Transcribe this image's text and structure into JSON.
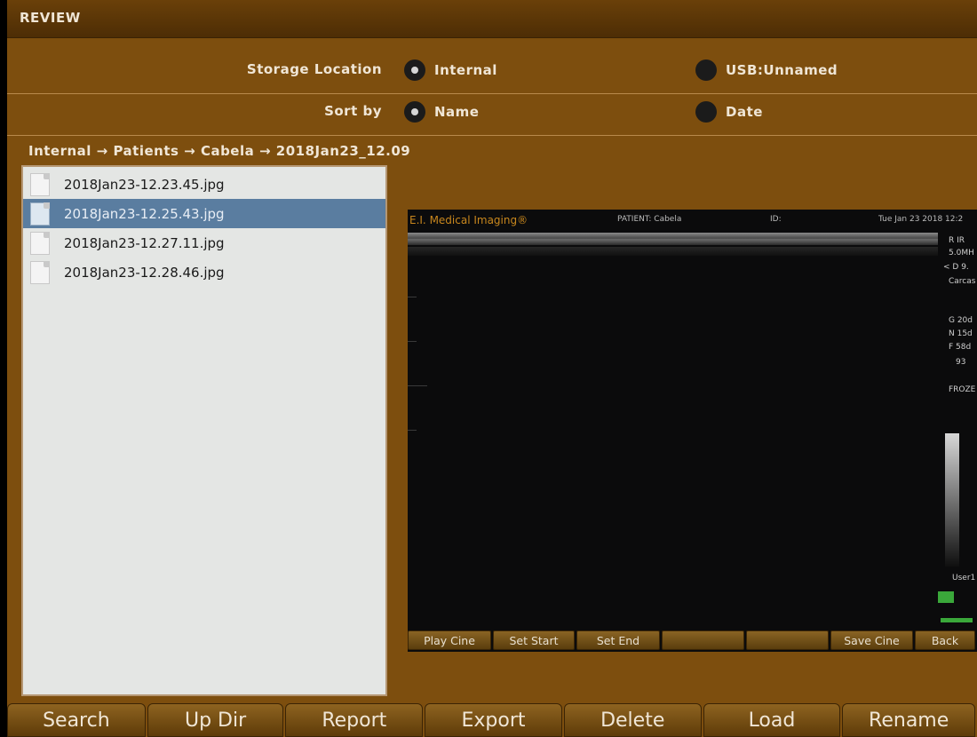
{
  "window": {
    "title": "REVIEW"
  },
  "storage": {
    "label": "Storage Location",
    "options": [
      {
        "label": "Internal",
        "selected": true
      },
      {
        "label": "USB:Unnamed",
        "selected": false
      }
    ]
  },
  "sort": {
    "label": "Sort by",
    "options": [
      {
        "label": "Name",
        "selected": true
      },
      {
        "label": "Date",
        "selected": false
      }
    ]
  },
  "breadcrumb": "Internal → Patients → Cabela → 2018Jan23_12.09",
  "files": [
    {
      "name": "2018Jan23-12.23.45.jpg",
      "selected": false
    },
    {
      "name": "2018Jan23-12.25.43.jpg",
      "selected": true
    },
    {
      "name": "2018Jan23-12.27.11.jpg",
      "selected": false
    },
    {
      "name": "2018Jan23-12.28.46.jpg",
      "selected": false
    }
  ],
  "preview": {
    "brand": "E.I. Medical Imaging®",
    "patient": "PATIENT: Cabela",
    "id": "ID:",
    "date": "Tue Jan 23 2018 12:2",
    "side": [
      "R  IR",
      "5.0MH",
      "< D 9.",
      "Carcas",
      "G 20d",
      "N 15d",
      "F 58d",
      "93",
      "FROZE",
      "User1"
    ],
    "buttons": [
      "Play Cine",
      "Set Start",
      "Set End",
      "",
      "",
      "Save Cine",
      "Back"
    ]
  },
  "toolbar": {
    "buttons": [
      "Search",
      "Up Dir",
      "Report",
      "Export",
      "Delete",
      "Load",
      "Rename"
    ]
  },
  "colors": {
    "background": "#7d4e0e",
    "selection": "#5a7da0",
    "brand": "#c8871d"
  }
}
